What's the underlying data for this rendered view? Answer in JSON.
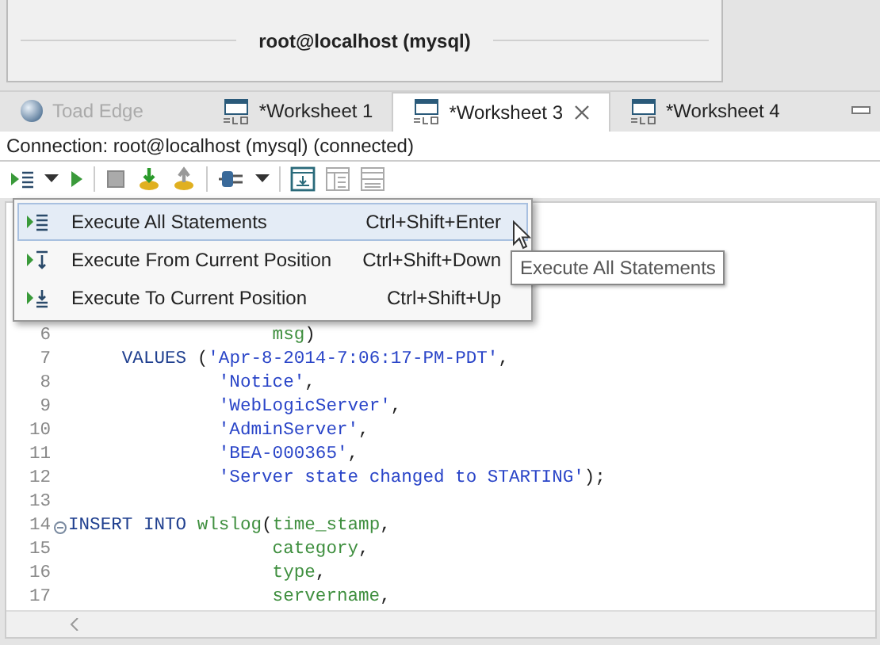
{
  "header": {
    "title": "root@localhost (mysql)"
  },
  "tabs": [
    {
      "label": "Toad Edge",
      "kind": "home",
      "selected": false,
      "disabled": true,
      "closable": false
    },
    {
      "label": "*Worksheet 1",
      "kind": "sql",
      "selected": false,
      "disabled": false,
      "closable": false
    },
    {
      "label": "*Worksheet 3",
      "kind": "sql",
      "selected": true,
      "disabled": false,
      "closable": true
    },
    {
      "label": "*Worksheet 4",
      "kind": "sql",
      "selected": false,
      "disabled": false,
      "closable": false
    }
  ],
  "connection": "Connection: root@localhost (mysql) (connected)",
  "menu": [
    {
      "kind": "all",
      "label": "Execute All Statements",
      "shortcut": "Ctrl+Shift+Enter",
      "selected": true
    },
    {
      "kind": "from",
      "label": "Execute From Current Position",
      "shortcut": "Ctrl+Shift+Down",
      "selected": false
    },
    {
      "kind": "to",
      "label": "Execute To Current Position",
      "shortcut": "Ctrl+Shift+Up",
      "selected": false
    }
  ],
  "tooltip": "Execute All Statements",
  "lines": [
    {
      "num": "6",
      "kind": "column",
      "fold": false,
      "segments": [
        {
          "kind": "ident",
          "text": "msg"
        },
        {
          "kind": "plain",
          "text": ")"
        }
      ]
    },
    {
      "num": "7",
      "kind": "clause",
      "fold": false,
      "segments": [
        {
          "kind": "keyword",
          "text": "VALUES"
        },
        {
          "kind": "plain",
          "text": " ("
        },
        {
          "kind": "string",
          "text": "'Apr-8-2014-7:06:17-PM-PDT'"
        },
        {
          "kind": "plain",
          "text": ","
        }
      ]
    },
    {
      "num": "8",
      "kind": "value",
      "fold": false,
      "segments": [
        {
          "kind": "string",
          "text": "'Notice'"
        },
        {
          "kind": "plain",
          "text": ","
        }
      ]
    },
    {
      "num": "9",
      "kind": "value",
      "fold": false,
      "segments": [
        {
          "kind": "string",
          "text": "'WebLogicServer'"
        },
        {
          "kind": "plain",
          "text": ","
        }
      ]
    },
    {
      "num": "10",
      "kind": "value",
      "fold": false,
      "segments": [
        {
          "kind": "string",
          "text": "'AdminServer'"
        },
        {
          "kind": "plain",
          "text": ","
        }
      ]
    },
    {
      "num": "11",
      "kind": "value",
      "fold": false,
      "segments": [
        {
          "kind": "string",
          "text": "'BEA-000365'"
        },
        {
          "kind": "plain",
          "text": ","
        }
      ]
    },
    {
      "num": "12",
      "kind": "value",
      "fold": false,
      "segments": [
        {
          "kind": "string",
          "text": "'Server state changed to STARTING'"
        },
        {
          "kind": "plain",
          "text": ");"
        }
      ]
    },
    {
      "num": "13",
      "fold": false
    },
    {
      "num": "14",
      "kind": "statement",
      "fold": true,
      "segments": [
        {
          "kind": "keyword",
          "text": "INSERT INTO"
        },
        {
          "kind": "space"
        },
        {
          "kind": "ident",
          "text": "wlslog"
        },
        {
          "kind": "plain",
          "text": "("
        },
        {
          "kind": "ident",
          "text": "time_stamp"
        },
        {
          "kind": "plain",
          "text": ","
        }
      ]
    },
    {
      "num": "15",
      "kind": "column",
      "fold": false,
      "segments": [
        {
          "kind": "ident",
          "text": "category"
        },
        {
          "kind": "plain",
          "text": ","
        }
      ]
    },
    {
      "num": "16",
      "kind": "column",
      "fold": false,
      "segments": [
        {
          "kind": "ident",
          "text": "type"
        },
        {
          "kind": "plain",
          "text": ","
        }
      ]
    },
    {
      "num": "17",
      "kind": "column",
      "fold": false,
      "segments": [
        {
          "kind": "ident",
          "text": "servername"
        },
        {
          "kind": "plain",
          "text": ","
        }
      ]
    }
  ]
}
